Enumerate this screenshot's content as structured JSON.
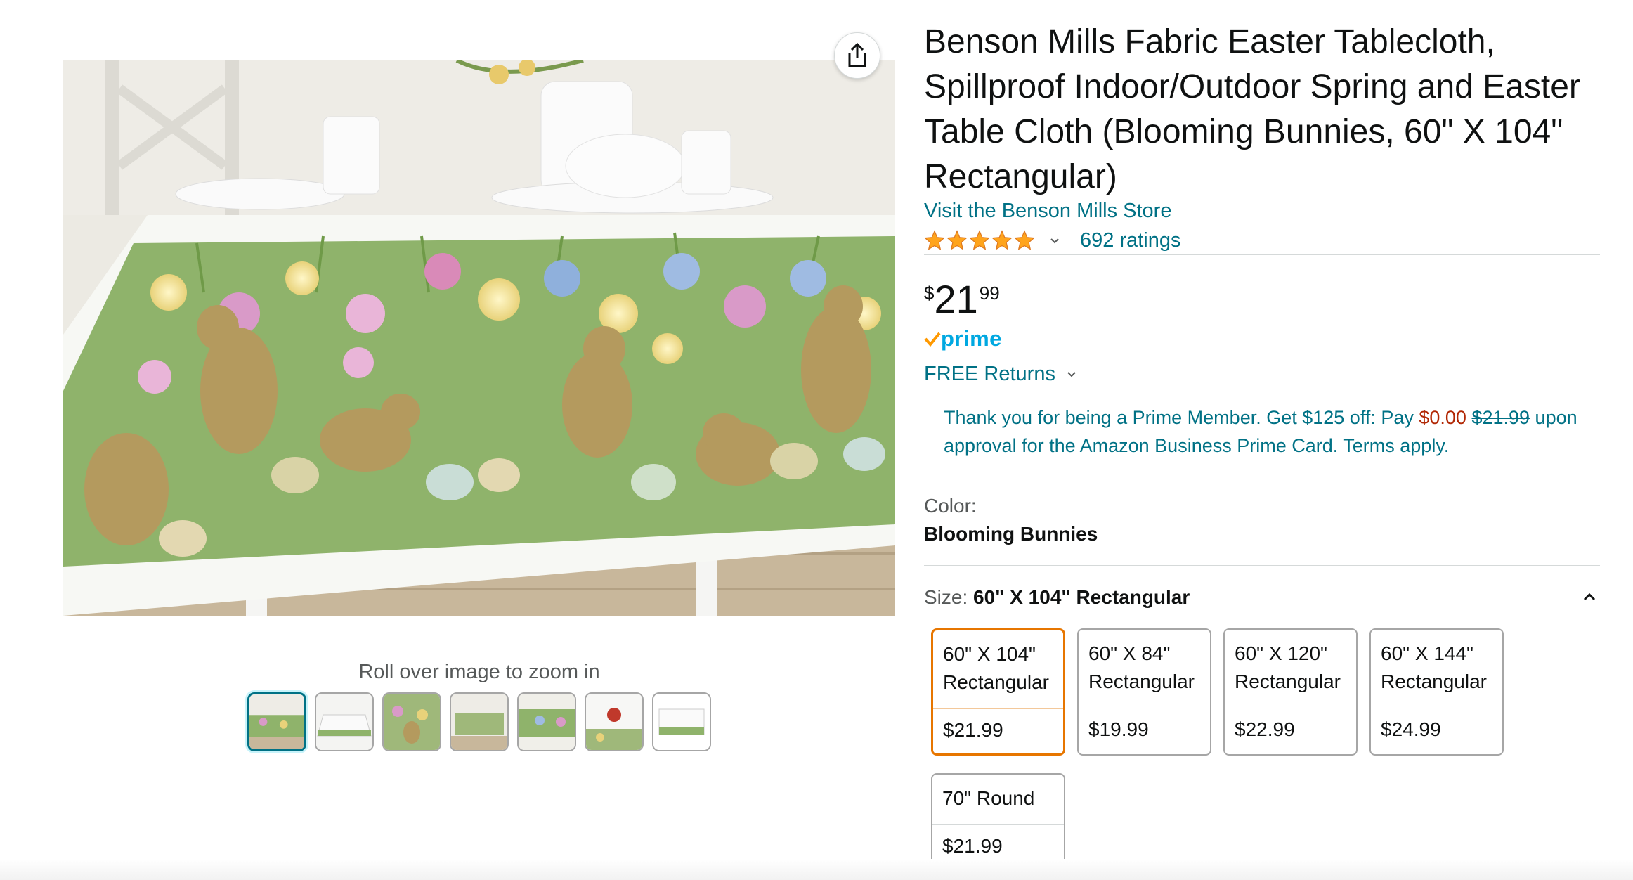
{
  "product": {
    "title": "Benson Mills Fabric Easter Tablecloth, Spillproof Indoor/Outdoor Spring and Easter Table Cloth (Blooming Bunnies, 60\" X 104\" Rectangular)",
    "store_link": "Visit the Benson Mills Store",
    "ratings_count": "692 ratings",
    "star_count": 5,
    "price": {
      "symbol": "$",
      "whole": "21",
      "fraction": "99"
    },
    "prime_label": "prime",
    "free_returns": "FREE Returns"
  },
  "gallery": {
    "zoom_hint": "Roll over image to zoom in",
    "share_icon": "share-icon",
    "thumbnails": [
      "thumb-1",
      "thumb-2",
      "thumb-3",
      "thumb-4",
      "thumb-5",
      "thumb-6",
      "thumb-7"
    ],
    "selected_thumbnail": 1
  },
  "promo": {
    "text_before": "Thank you for being a Prime Member. Get $125 off: Pay ",
    "pay_amount": "$0.00",
    "original_price": "$21.99",
    "text_after": " upon approval for the Amazon Business Prime Card. Terms apply."
  },
  "color": {
    "label": "Color:",
    "value": "Blooming Bunnies"
  },
  "size": {
    "label": "Size: ",
    "value": "60\" X 104\" Rectangular",
    "options": [
      {
        "line1": "60\" X 104\"",
        "line2": "Rectangular",
        "price": "$21.99",
        "selected": true
      },
      {
        "line1": "60\" X 84\"",
        "line2": "Rectangular",
        "price": "$19.99",
        "selected": false
      },
      {
        "line1": "60\" X 120\"",
        "line2": "Rectangular",
        "price": "$22.99",
        "selected": false
      },
      {
        "line1": "60\" X 144\"",
        "line2": "Rectangular",
        "price": "$24.99",
        "selected": false
      },
      {
        "line1": "70\" Round",
        "line2": "",
        "price": "$21.99",
        "selected": false
      }
    ]
  },
  "colors": {
    "link": "#007185",
    "star": "#ffa41c",
    "prime_blue": "#00a8e1",
    "prime_check": "#ff9900",
    "promo_red": "#b12704",
    "selected_border": "#e77600"
  }
}
